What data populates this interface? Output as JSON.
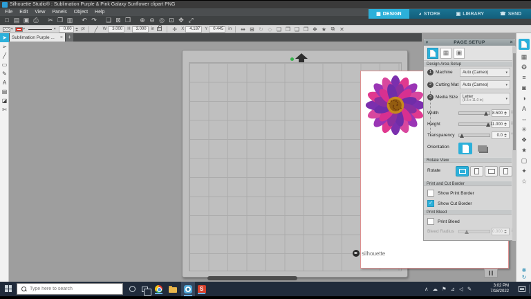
{
  "window": {
    "title": "Silhouette Studio® : Sublimation Purple & Pink Galaxy Sunflower clipart PNG"
  },
  "menu": {
    "items": [
      "File",
      "Edit",
      "View",
      "Panels",
      "Object",
      "Help"
    ]
  },
  "nav": {
    "tabs": [
      {
        "label": "DESIGN",
        "glyph": "▦"
      },
      {
        "label": "STORE",
        "glyph": "◕"
      },
      {
        "label": "LIBRARY",
        "glyph": "▣"
      },
      {
        "label": "SEND",
        "glyph": "☎"
      }
    ]
  },
  "quick_toolbar": {
    "icons": [
      {
        "name": "new-file-icon",
        "glyph": "□"
      },
      {
        "name": "open-file-icon",
        "glyph": "▤"
      },
      {
        "name": "save-file-icon",
        "glyph": "▣"
      },
      {
        "name": "print-icon",
        "glyph": "⎙"
      },
      {
        "name": "cut-icon",
        "glyph": "✂",
        "gap": true
      },
      {
        "name": "copy-icon",
        "glyph": "❐"
      },
      {
        "name": "paste-icon",
        "glyph": "▥"
      },
      {
        "name": "undo-icon",
        "glyph": "↶",
        "gap": true
      },
      {
        "name": "redo-icon",
        "glyph": "↷"
      },
      {
        "name": "paste-in-place-icon",
        "glyph": "❑",
        "gap": true
      },
      {
        "name": "delete-icon",
        "glyph": "⊠"
      },
      {
        "name": "duplicate-icon",
        "glyph": "❒"
      },
      {
        "name": "zoom-in-icon",
        "glyph": "⊕",
        "gap": true
      },
      {
        "name": "zoom-out-icon",
        "glyph": "⊖"
      },
      {
        "name": "drag-zoom-icon",
        "glyph": "◎"
      },
      {
        "name": "fit-to-page-icon",
        "glyph": "⊡"
      },
      {
        "name": "pan-icon",
        "glyph": "✥"
      },
      {
        "name": "fullscreen-icon",
        "glyph": "⤢"
      }
    ]
  },
  "options_toolbar": {
    "caret": "▾",
    "stroke_weight": "0.00",
    "stroke_unit": "pt",
    "w_label": "W",
    "width": "3.000",
    "h_label": "H",
    "height": "3.000",
    "size_unit": "in",
    "x_label": "X",
    "x_value": "4.187",
    "y_label": "Y",
    "y_value": "0.445",
    "pos_unit": "in",
    "line_tool_glyph": "╱",
    "move_tool_glyph": "✛",
    "icons": [
      {
        "name": "center-align-icon",
        "glyph": "⇹"
      },
      {
        "name": "center-to-page-icon",
        "glyph": "⊞"
      },
      {
        "name": "rotate-icon",
        "glyph": "↻",
        "dim": true
      },
      {
        "name": "shape-icon",
        "glyph": "◇",
        "dim": true
      },
      {
        "name": "bring-to-front-icon",
        "glyph": "❏"
      },
      {
        "name": "bring-forward-icon",
        "glyph": "❐"
      },
      {
        "name": "send-backward-icon",
        "glyph": "❑"
      },
      {
        "name": "send-to-back-icon",
        "glyph": "❒"
      },
      {
        "name": "group-icon",
        "glyph": "❖"
      },
      {
        "name": "star-icon",
        "glyph": "★"
      },
      {
        "name": "copies-icon",
        "glyph": "⧉"
      },
      {
        "name": "delete-selection-icon",
        "glyph": "✕"
      }
    ]
  },
  "tools": {
    "icons": [
      {
        "name": "point-edit-tool-icon",
        "glyph": "➢"
      },
      {
        "name": "line-tool-icon",
        "glyph": "╱"
      },
      {
        "name": "rectangle-tool-icon",
        "glyph": "▭"
      },
      {
        "name": "draw-tool-icon",
        "glyph": "✎"
      },
      {
        "name": "text-tool-icon",
        "glyph": "A"
      },
      {
        "name": "notes-tool-icon",
        "glyph": "▤"
      },
      {
        "name": "eraser-tool-icon",
        "glyph": "◪"
      },
      {
        "name": "knife-tool-icon",
        "glyph": "✄"
      }
    ]
  },
  "doc_tab": {
    "title": "Sublimation Purple ...",
    "close": "×",
    "add": "+"
  },
  "canvas": {
    "selection_width": "3.000 in",
    "selection_height": "3.000 in",
    "logo": "silhouette"
  },
  "panel": {
    "title": "PAGE SETUP",
    "collapse": "▾",
    "close": "×",
    "caret": "▾",
    "check_glyph": "✓",
    "design_area_section": "Design Area Setup",
    "machine": {
      "num": "1",
      "label": "Machine",
      "value": "Auto (Cameo)"
    },
    "cutting_mat": {
      "num": "2",
      "label": "Cutting Mat",
      "value": "Auto (Cameo)"
    },
    "media_size": {
      "num": "3",
      "label": "Media Size",
      "value": "Letter",
      "value_sub": "(8.5 x 11.0 in)"
    },
    "width": {
      "label": "Width",
      "value": "8.500",
      "unit": "in"
    },
    "height": {
      "label": "Height",
      "value": "11.000",
      "unit": "in"
    },
    "transparency": {
      "label": "Transparency",
      "value": "0.0",
      "unit": "%"
    },
    "orientation_label": "Orientation",
    "rotate_section": "Rotate View",
    "rotate_label": "Rotate",
    "border_section": "Print and Cut Border",
    "show_print_border": "Show Print Border",
    "show_cut_border": "Show Cut Border",
    "bleed_section": "Print Bleed",
    "print_bleed": "Print Bleed",
    "bleed_radius": {
      "label": "Bleed Radius",
      "value": "0.000",
      "unit": "in"
    }
  },
  "side_strip": {
    "icons": [
      {
        "name": "transform-panel-icon",
        "glyph": "▦"
      },
      {
        "name": "fill-panel-icon",
        "glyph": "❂"
      },
      {
        "name": "line-style-panel-icon",
        "glyph": "≡"
      },
      {
        "name": "trace-panel-icon",
        "glyph": "◙"
      },
      {
        "name": "image-effects-panel-icon",
        "glyph": "◑"
      },
      {
        "name": "text-style-panel-icon",
        "glyph": "A"
      },
      {
        "name": "align-panel-icon",
        "glyph": "⇔"
      },
      {
        "name": "modify-panel-icon",
        "glyph": "✳"
      },
      {
        "name": "replicate-panel-icon",
        "glyph": "❖"
      },
      {
        "name": "offset-panel-icon",
        "glyph": "★"
      },
      {
        "name": "preview-panel-icon",
        "glyph": "▢"
      },
      {
        "name": "sketch-panel-icon",
        "glyph": "✦"
      },
      {
        "name": "favorites-panel-icon",
        "glyph": "☆"
      }
    ]
  },
  "taskbar": {
    "search_placeholder": "Type here to search",
    "time": "3:02 PM",
    "date": "7/18/2022",
    "s_app_glyph": "S",
    "tray_icons": [
      {
        "name": "hidden-icons-chevron",
        "glyph": "∧"
      },
      {
        "name": "onedrive-icon",
        "glyph": "☁"
      },
      {
        "name": "security-icon",
        "glyph": "⚑"
      },
      {
        "name": "network-icon",
        "glyph": "⊿"
      },
      {
        "name": "volume-icon",
        "glyph": "◁"
      },
      {
        "name": "pen-icon",
        "glyph": "✎"
      }
    ]
  },
  "colors": {
    "accent": "#2cb0da",
    "nav_bg": "#16688a",
    "taskbar_bg": "#202b3b",
    "cut_border": "#dd9090",
    "mat": "#bfbfbf",
    "selection": "#9a9a9a"
  },
  "flower": {
    "outer_colors": [
      "#7b2fae",
      "#e0398f",
      "#9a35b5",
      "#d8479e"
    ],
    "inner_colors": [
      "#8a2f9f",
      "#d83090",
      "#6f2da8"
    ],
    "center": "#c8881e",
    "center_dark": "#935c10",
    "speckle": "#6e3a0c"
  }
}
